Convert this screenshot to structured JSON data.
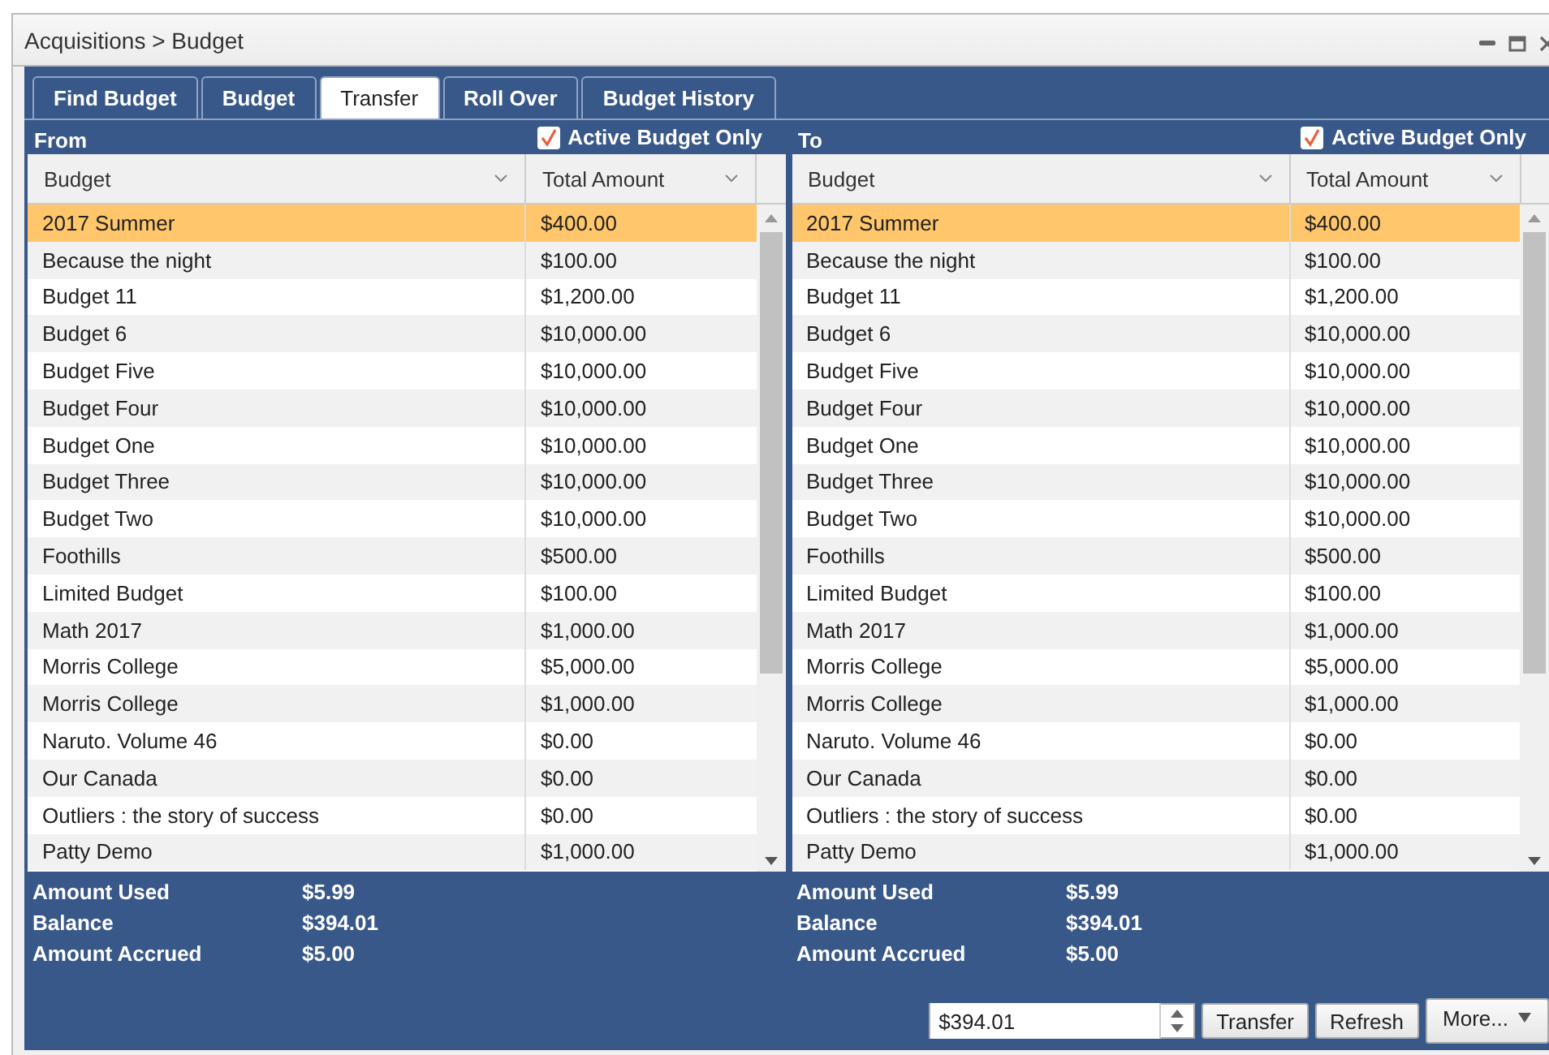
{
  "window": {
    "title": "Acquisitions > Budget"
  },
  "tabs": [
    {
      "label": "Find Budget",
      "selected": false
    },
    {
      "label": "Budget",
      "selected": false
    },
    {
      "label": "Transfer",
      "selected": true
    },
    {
      "label": "Roll Over",
      "selected": false
    },
    {
      "label": "Budget History",
      "selected": false
    }
  ],
  "panes": [
    {
      "label": "From",
      "active_only": {
        "label": "Active Budget Only",
        "checked": true
      },
      "columns": [
        "Budget",
        "Total Amount"
      ],
      "rows": [
        {
          "budget": "2017 Summer",
          "amount": "$400.00",
          "selected": true
        },
        {
          "budget": "Because the night",
          "amount": "$100.00",
          "selected": false
        },
        {
          "budget": "Budget 11",
          "amount": "$1,200.00",
          "selected": false
        },
        {
          "budget": "Budget 6",
          "amount": "$10,000.00",
          "selected": false
        },
        {
          "budget": "Budget Five",
          "amount": "$10,000.00",
          "selected": false
        },
        {
          "budget": "Budget Four",
          "amount": "$10,000.00",
          "selected": false
        },
        {
          "budget": "Budget One",
          "amount": "$10,000.00",
          "selected": false
        },
        {
          "budget": "Budget Three",
          "amount": "$10,000.00",
          "selected": false
        },
        {
          "budget": "Budget Two",
          "amount": "$10,000.00",
          "selected": false
        },
        {
          "budget": "Foothills",
          "amount": "$500.00",
          "selected": false
        },
        {
          "budget": "Limited Budget",
          "amount": "$100.00",
          "selected": false
        },
        {
          "budget": "Math 2017",
          "amount": "$1,000.00",
          "selected": false
        },
        {
          "budget": "Morris College",
          "amount": "$5,000.00",
          "selected": false
        },
        {
          "budget": "Morris College",
          "amount": "$1,000.00",
          "selected": false
        },
        {
          "budget": "Naruto. Volume 46",
          "amount": "$0.00",
          "selected": false
        },
        {
          "budget": "Our Canada",
          "amount": "$0.00",
          "selected": false
        },
        {
          "budget": "Outliers : the story of success",
          "amount": "$0.00",
          "selected": false
        },
        {
          "budget": "Patty Demo",
          "amount": "$1,000.00",
          "selected": false
        }
      ],
      "summary": [
        {
          "label": "Amount Used",
          "value": "$5.99"
        },
        {
          "label": "Balance",
          "value": "$394.01"
        },
        {
          "label": "Amount Accrued",
          "value": "$5.00"
        }
      ]
    },
    {
      "label": "To",
      "active_only": {
        "label": "Active Budget Only",
        "checked": true
      },
      "columns": [
        "Budget",
        "Total Amount"
      ],
      "rows": [
        {
          "budget": "2017 Summer",
          "amount": "$400.00",
          "selected": true
        },
        {
          "budget": "Because the night",
          "amount": "$100.00",
          "selected": false
        },
        {
          "budget": "Budget 11",
          "amount": "$1,200.00",
          "selected": false
        },
        {
          "budget": "Budget 6",
          "amount": "$10,000.00",
          "selected": false
        },
        {
          "budget": "Budget Five",
          "amount": "$10,000.00",
          "selected": false
        },
        {
          "budget": "Budget Four",
          "amount": "$10,000.00",
          "selected": false
        },
        {
          "budget": "Budget One",
          "amount": "$10,000.00",
          "selected": false
        },
        {
          "budget": "Budget Three",
          "amount": "$10,000.00",
          "selected": false
        },
        {
          "budget": "Budget Two",
          "amount": "$10,000.00",
          "selected": false
        },
        {
          "budget": "Foothills",
          "amount": "$500.00",
          "selected": false
        },
        {
          "budget": "Limited Budget",
          "amount": "$100.00",
          "selected": false
        },
        {
          "budget": "Math 2017",
          "amount": "$1,000.00",
          "selected": false
        },
        {
          "budget": "Morris College",
          "amount": "$5,000.00",
          "selected": false
        },
        {
          "budget": "Morris College",
          "amount": "$1,000.00",
          "selected": false
        },
        {
          "budget": "Naruto. Volume 46",
          "amount": "$0.00",
          "selected": false
        },
        {
          "budget": "Our Canada",
          "amount": "$0.00",
          "selected": false
        },
        {
          "budget": "Outliers : the story of success",
          "amount": "$0.00",
          "selected": false
        },
        {
          "budget": "Patty Demo",
          "amount": "$1,000.00",
          "selected": false
        }
      ],
      "summary": [
        {
          "label": "Amount Used",
          "value": "$5.99"
        },
        {
          "label": "Balance",
          "value": "$394.01"
        },
        {
          "label": "Amount Accrued",
          "value": "$5.00"
        }
      ]
    }
  ],
  "transfer": {
    "amount": "$394.01",
    "buttons": [
      "Transfer",
      "Refresh",
      "More..."
    ]
  }
}
